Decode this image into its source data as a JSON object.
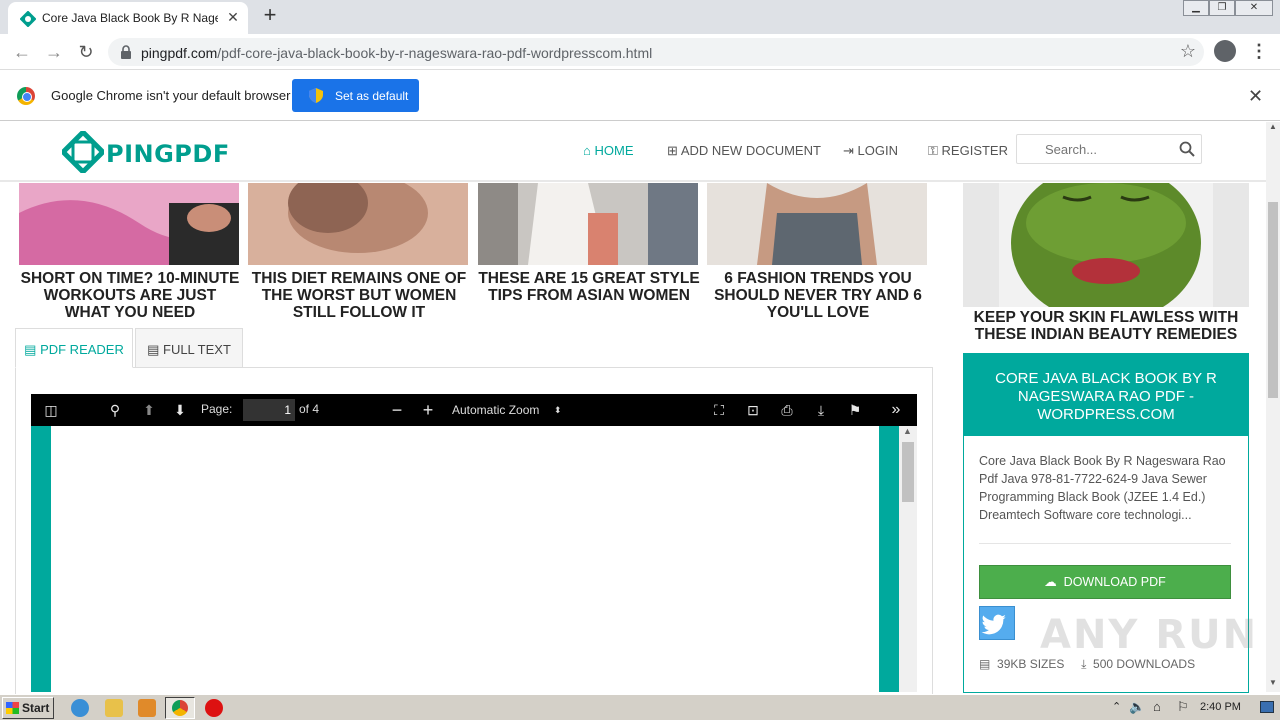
{
  "browser": {
    "tab_title": "Core Java Black Book By R Nageswara Rao",
    "tab_close": "✕",
    "new_tab": "+",
    "url_domain": "pingpdf.com",
    "url_path": "/pdf-core-java-black-book-by-r-nageswara-rao-pdf-wordpresscom.html",
    "window_buttons": [
      "▁",
      "❐",
      "✕"
    ]
  },
  "infobar": {
    "message": "Google Chrome isn't your default browser",
    "set_default_label": "Set as default"
  },
  "site": {
    "logo_text": "PINGPDF",
    "nav": {
      "home": "HOME",
      "add_document": "ADD NEW DOCUMENT",
      "login": "LOGIN",
      "register": "REGISTER"
    },
    "search_placeholder": "Search...",
    "accent_color": "#00a99d"
  },
  "ad_cards": [
    {
      "caption": "SHORT ON TIME? 10-MINUTE WORKOUTS ARE JUST WHAT YOU NEED"
    },
    {
      "caption": "THIS DIET REMAINS ONE OF THE WORST BUT WOMEN STILL FOLLOW IT"
    },
    {
      "caption": "THESE ARE 15 GREAT STYLE TIPS FROM ASIAN WOMEN"
    },
    {
      "caption": "6 FASHION TRENDS YOU SHOULD NEVER TRY AND 6 YOU'LL LOVE"
    }
  ],
  "reader_tabs": {
    "pdf_reader": "PDF READER",
    "full_text": "FULL TEXT"
  },
  "pdf_viewer": {
    "page_label": "Page:",
    "page_value": "1",
    "page_of": "of 4",
    "zoom": "Automatic Zoom"
  },
  "sidebar": {
    "ad_caption": "KEEP YOUR SKIN FLAWLESS WITH THESE INDIAN BEAUTY REMEDIES",
    "doc_title": "CORE JAVA BLACK BOOK BY R NAGESWARA RAO PDF - WORDPRESS.COM",
    "doc_description": "Core Java Black Book By R Nageswara Rao Pdf Java 978-81-7722-624-9 Java Sewer Programming Black Book (JZEE 1.4 Ed.) Dreamtech Software core technologi...",
    "download_label": "DOWNLOAD PDF",
    "size": "39KB SIZES",
    "downloads": "500 DOWNLOADS"
  },
  "watermark": "ANY RUN",
  "taskbar": {
    "start_label": "Start",
    "clock": "2:40 PM"
  }
}
